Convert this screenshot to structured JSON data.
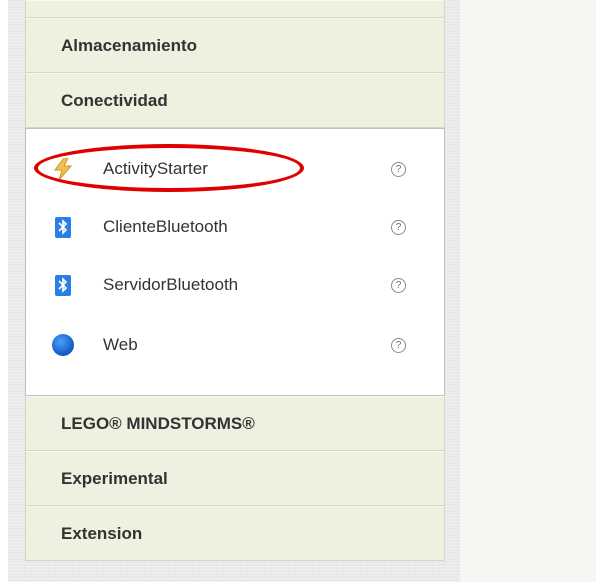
{
  "palette": {
    "categories_above": [
      {
        "label": "Almacenamiento"
      },
      {
        "label": "Conectividad"
      }
    ],
    "open_category": {
      "items": [
        {
          "label": "ActivityStarter",
          "icon": "lightning-bolt-icon",
          "help": "?"
        },
        {
          "label": "ClienteBluetooth",
          "icon": "bluetooth-icon",
          "help": "?"
        },
        {
          "label": "ServidorBluetooth",
          "icon": "bluetooth-icon",
          "help": "?"
        },
        {
          "label": "Web",
          "icon": "globe-icon",
          "help": "?"
        }
      ]
    },
    "categories_below": [
      {
        "label": "LEGO® MINDSTORMS®"
      },
      {
        "label": "Experimental"
      },
      {
        "label": "Extension"
      }
    ]
  },
  "annotation": {
    "color": "#e00000",
    "highlighted_item": "ActivityStarter"
  },
  "colors": {
    "category_bg": "#eef0e0",
    "bluetooth": "#2a7fe0"
  }
}
